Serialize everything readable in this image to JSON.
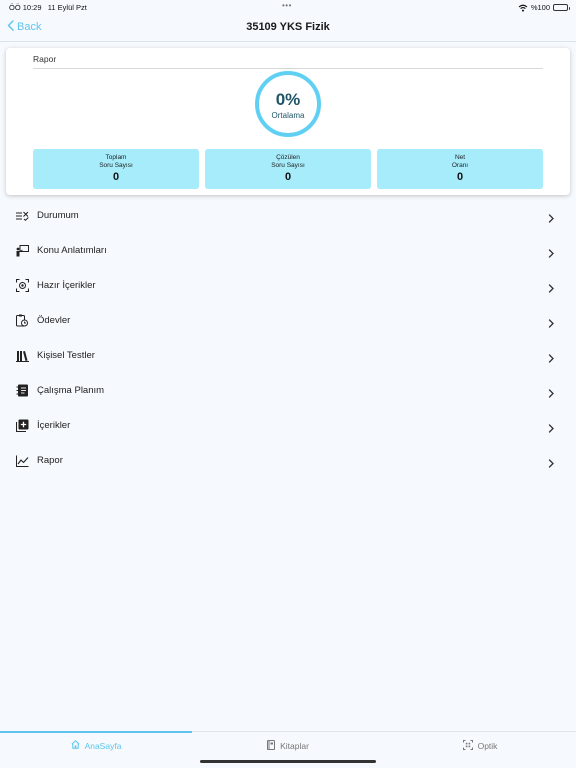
{
  "status_bar": {
    "time": "ÖÖ 10:29",
    "date": "11 Eylül Pzt",
    "dots": "•••",
    "battery": "%100"
  },
  "nav": {
    "back_label": "Back",
    "title": "35109 YKS Fizik"
  },
  "report": {
    "section_label": "Rapor",
    "average_value": "0%",
    "average_label": "Ortalama",
    "stats": [
      {
        "line1": "Toplam",
        "line2": "Soru Sayısı",
        "value": "0"
      },
      {
        "line1": "Çözülen",
        "line2": "Soru Sayısı",
        "value": "0"
      },
      {
        "line1": "Net",
        "line2": "Oranı",
        "value": "0"
      }
    ]
  },
  "menu": {
    "items": [
      {
        "label": "Durumum",
        "icon": "checklist-icon"
      },
      {
        "label": "Konu Anlatımları",
        "icon": "presentation-icon"
      },
      {
        "label": "Hazır İçerikler",
        "icon": "scan-icon"
      },
      {
        "label": "Ödevler",
        "icon": "homework-icon"
      },
      {
        "label": "Kişisel Testler",
        "icon": "library-icon"
      },
      {
        "label": "Çalışma Planım",
        "icon": "notebook-icon"
      },
      {
        "label": "İçerikler",
        "icon": "add-content-icon"
      },
      {
        "label": "Rapor",
        "icon": "line-chart-icon"
      }
    ]
  },
  "tabs": [
    {
      "label": "AnaSayfa",
      "icon": "home-icon",
      "active": true
    },
    {
      "label": "Kitaplar",
      "icon": "book-icon",
      "active": false
    },
    {
      "label": "Optik",
      "icon": "optic-scan-icon",
      "active": false
    }
  ],
  "colors": {
    "accent": "#5ec6ee",
    "ring": "#5fd0f3",
    "stat_box": "#a6ecfb",
    "background": "#f6f9fd"
  }
}
